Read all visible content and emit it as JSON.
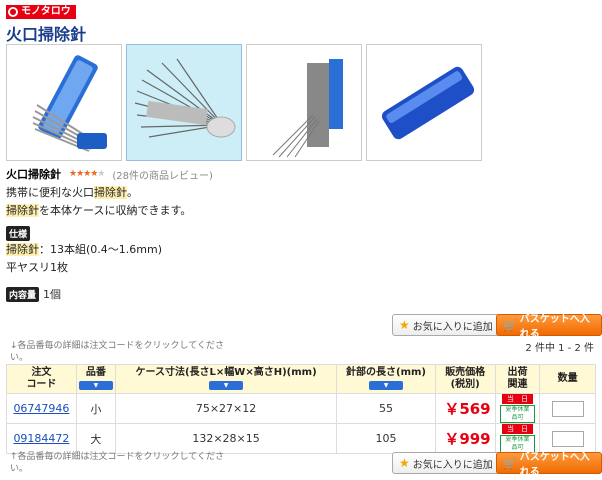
{
  "logo": {
    "text": "モノタロウ"
  },
  "title": "火口掃除針",
  "product": {
    "name": "火口掃除針",
    "stars": "★★★★",
    "stars_off": "★",
    "reviews": "(28件の商品レビュー)"
  },
  "desc": {
    "line1_a": "携帯に便利な火口",
    "line1_hl": "掃除針",
    "line1_b": "。",
    "line2_hl": "掃除針",
    "line2_b": "を本体ケースに収納できます。"
  },
  "spec": {
    "heading": "仕様",
    "line1_hl": "掃除針",
    "line1_b": "：13本組(0.4〜1.6mm)",
    "line2": "平ヤスリ1枚"
  },
  "contents": {
    "label": "内容量",
    "value": "1個"
  },
  "buttons": {
    "favorite": "お気に入りに追加",
    "cart": "バスケットへ入れる"
  },
  "notes": {
    "top": "↓各品番毎の詳細は注文コードをクリックしてください。",
    "bottom": "↑各品番毎の詳細は注文コードをクリックしてください。"
  },
  "count": "2 件中 1 - 2 件",
  "table": {
    "headers": {
      "code": "注文\nコード",
      "hinban": "品番",
      "case": "ケース寸法(長さL×幅W×高さH)(mm)",
      "needle": "針部の長さ(mm)",
      "price": "販売価格\n(税別)",
      "ship": "出荷\n関連",
      "qty": "数量"
    },
    "sort_label": "▼",
    "rows": [
      {
        "code": "06747946",
        "hinban": "小",
        "case": "75×27×12",
        "needle": "55",
        "price": "￥569",
        "badge1": "当　日",
        "badge2": "夏季休業品可"
      },
      {
        "code": "09184472",
        "hinban": "大",
        "case": "132×28×15",
        "needle": "105",
        "price": "￥999",
        "badge1": "当　日",
        "badge2": "夏季休業品可"
      }
    ]
  }
}
